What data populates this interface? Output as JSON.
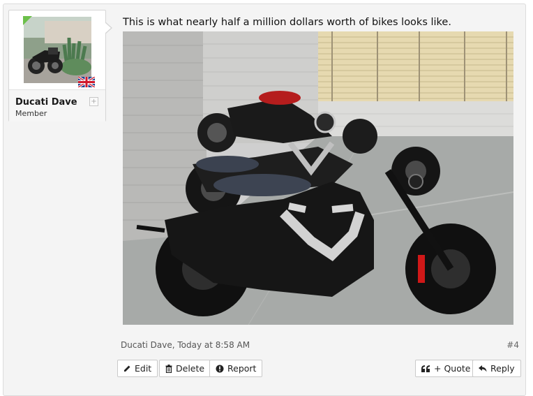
{
  "post": {
    "user": {
      "name": "Ducati Dave",
      "title": "Member",
      "expand_symbol": "+"
    },
    "message": "This is what nearly half a million dollars worth of bikes looks like.",
    "meta": "Ducati Dave, Today at 8:58 AM",
    "permalink": "#4",
    "actions": {
      "edit": "Edit",
      "delete": "Delete",
      "report": "Report",
      "quote": "+ Quote",
      "reply": "Reply"
    }
  }
}
